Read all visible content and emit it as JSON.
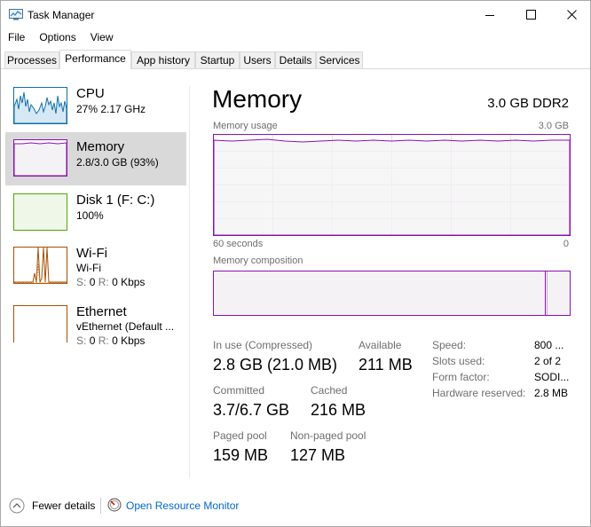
{
  "window": {
    "title": "Task Manager",
    "minimize_icon": "minimize-icon",
    "maximize_icon": "maximize-icon",
    "close_icon": "close-icon"
  },
  "menu": {
    "file": "File",
    "options": "Options",
    "view": "View"
  },
  "tabs": [
    {
      "label": "Processes"
    },
    {
      "label": "Performance",
      "active": true
    },
    {
      "label": "App history"
    },
    {
      "label": "Startup"
    },
    {
      "label": "Users"
    },
    {
      "label": "Details"
    },
    {
      "label": "Services"
    }
  ],
  "sidebar": {
    "cpu": {
      "name": "CPU",
      "detail": "27%  2.17 GHz",
      "color": "#1170aa"
    },
    "memory": {
      "name": "Memory",
      "detail": "2.8/3.0 GB (93%)",
      "color": "#8b12ae",
      "selected": true
    },
    "disk": {
      "name": "Disk 1 (F: C:)",
      "detail": "100%",
      "color": "#4da60c"
    },
    "wifi": {
      "name": "Wi-Fi",
      "sub": "Wi-Fi",
      "send_label": "S:",
      "send_value": "0",
      "recv_label": "R:",
      "recv_value": "0 Kbps",
      "color": "#a74f01"
    },
    "ethernet": {
      "name": "Ethernet",
      "sub": "vEthernet (Default ...",
      "send_label": "S:",
      "send_value": "0",
      "recv_label": "R:",
      "recv_value": "0 Kbps",
      "color": "#a74f01"
    }
  },
  "main": {
    "title": "Memory",
    "capacity": "3.0 GB DDR2",
    "usage_label": "Memory usage",
    "usage_max": "3.0 GB",
    "time_left": "60 seconds",
    "time_right": "0",
    "composition_label": "Memory composition",
    "in_use_fraction": 0.93,
    "stats": {
      "in_use_label": "In use (Compressed)",
      "in_use_value": "2.8 GB (21.0 MB)",
      "available_label": "Available",
      "available_value": "211 MB",
      "committed_label": "Committed",
      "committed_value": "3.7/6.7 GB",
      "cached_label": "Cached",
      "cached_value": "216 MB",
      "paged_label": "Paged pool",
      "paged_value": "159 MB",
      "nonpaged_label": "Non-paged pool",
      "nonpaged_value": "127 MB"
    },
    "props": {
      "speed_label": "Speed:",
      "speed_value": "800 ...",
      "slots_label": "Slots used:",
      "slots_value": "2 of 2",
      "form_label": "Form factor:",
      "form_value": "SODI...",
      "reserved_label": "Hardware reserved:",
      "reserved_value": "2.8 MB"
    }
  },
  "footer": {
    "fewer_details": "Fewer details",
    "resource_monitor": "Open Resource Monitor"
  }
}
